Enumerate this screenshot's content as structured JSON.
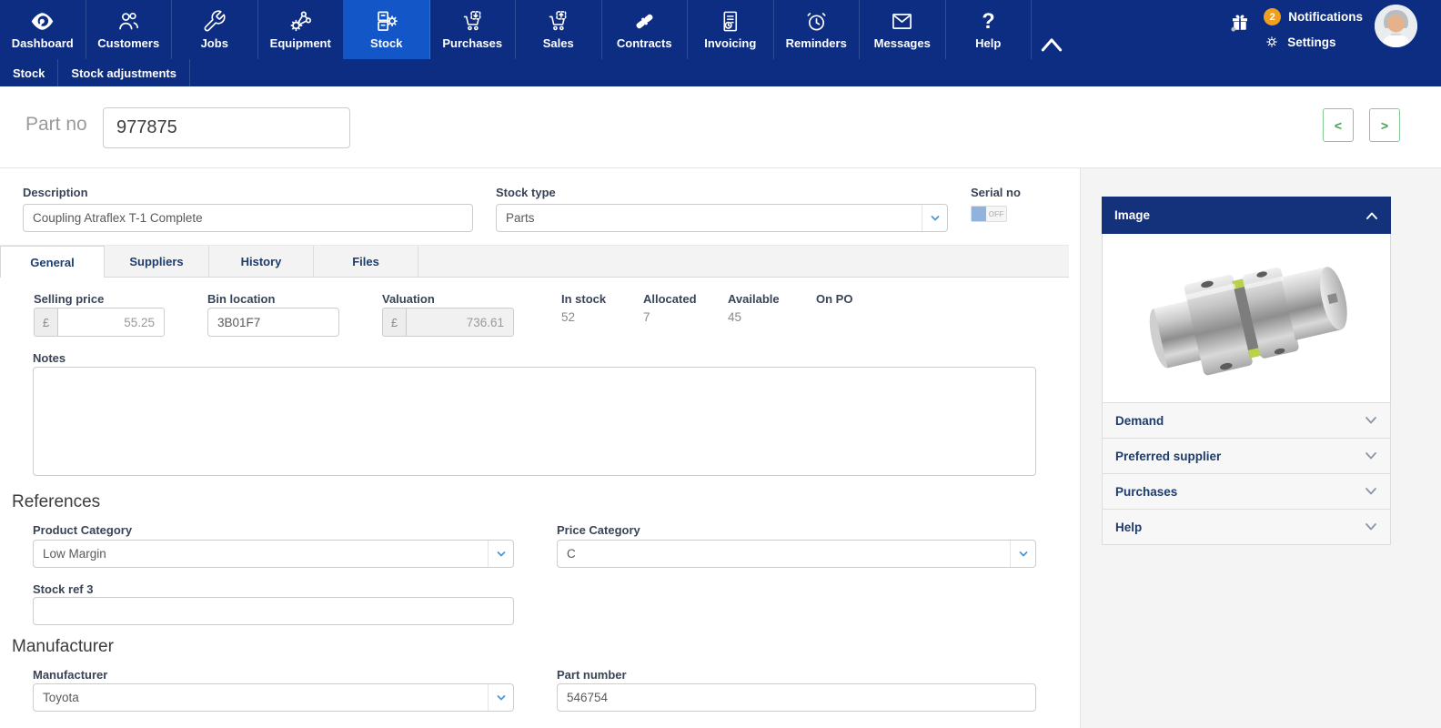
{
  "colors": {
    "nav_bg": "#0c2d82",
    "nav_active": "#1256c8",
    "badge_orange": "#f0a01e",
    "accent_blue": "#4a97d2",
    "button_green": "#3fa24c",
    "panel_header_bg": "#14317c"
  },
  "nav": {
    "items": [
      {
        "label": "Dashboard",
        "icon": "protean-logo-icon"
      },
      {
        "label": "Customers",
        "icon": "people-icon"
      },
      {
        "label": "Jobs",
        "icon": "wrench-icon"
      },
      {
        "label": "Equipment",
        "icon": "gear-nodes-icon"
      },
      {
        "label": "Stock",
        "icon": "cabinet-gear-icon",
        "active": true
      },
      {
        "label": "Purchases",
        "icon": "cart-arrow-down-icon"
      },
      {
        "label": "Sales",
        "icon": "cart-arrow-up-icon"
      },
      {
        "label": "Contracts",
        "icon": "handshake-icon"
      },
      {
        "label": "Invoicing",
        "icon": "invoice-clock-icon"
      },
      {
        "label": "Reminders",
        "icon": "alarm-clock-icon"
      },
      {
        "label": "Messages",
        "icon": "envelope-icon"
      },
      {
        "label": "Help",
        "icon": "question-mark-icon"
      }
    ],
    "subtabs": [
      {
        "label": "Stock"
      },
      {
        "label": "Stock adjustments"
      }
    ],
    "notifications": {
      "badge_count": "2",
      "label": "Notifications"
    },
    "settings_label": "Settings"
  },
  "header": {
    "part_no_label": "Part no",
    "part_no_value": "977875",
    "prev_label": "<",
    "next_label": ">"
  },
  "form": {
    "description": {
      "label": "Description",
      "value": "Coupling Atraflex T-1 Complete"
    },
    "stock_type": {
      "label": "Stock type",
      "value": "Parts"
    },
    "serial_no": {
      "label": "Serial no",
      "state": "OFF"
    },
    "tabs": [
      {
        "label": "General",
        "active": true
      },
      {
        "label": "Suppliers"
      },
      {
        "label": "History"
      },
      {
        "label": "Files"
      }
    ],
    "selling_price": {
      "label": "Selling price",
      "currency": "£",
      "value": "55.25"
    },
    "bin_location": {
      "label": "Bin location",
      "value": "3B01F7"
    },
    "valuation": {
      "label": "Valuation",
      "currency": "£",
      "value": "736.61"
    },
    "stats": [
      {
        "label": "In stock",
        "value": "52"
      },
      {
        "label": "Allocated",
        "value": "7"
      },
      {
        "label": "Available",
        "value": "45"
      },
      {
        "label": "On PO",
        "value": ""
      }
    ],
    "notes": {
      "label": "Notes",
      "value": ""
    },
    "references": {
      "title": "References",
      "product_category": {
        "label": "Product Category",
        "value": "Low Margin"
      },
      "price_category": {
        "label": "Price Category",
        "value": "C"
      },
      "stock_ref3": {
        "label": "Stock ref 3",
        "value": ""
      }
    },
    "manufacturer_section": {
      "title": "Manufacturer",
      "manufacturer": {
        "label": "Manufacturer",
        "value": "Toyota"
      },
      "part_number": {
        "label": "Part number",
        "value": "546754"
      }
    }
  },
  "sidebar": {
    "panels": [
      {
        "title": "Image",
        "expanded": true
      },
      {
        "title": "Demand",
        "expanded": false
      },
      {
        "title": "Preferred supplier",
        "expanded": false
      },
      {
        "title": "Purchases",
        "expanded": false
      },
      {
        "title": "Help",
        "expanded": false
      }
    ]
  }
}
